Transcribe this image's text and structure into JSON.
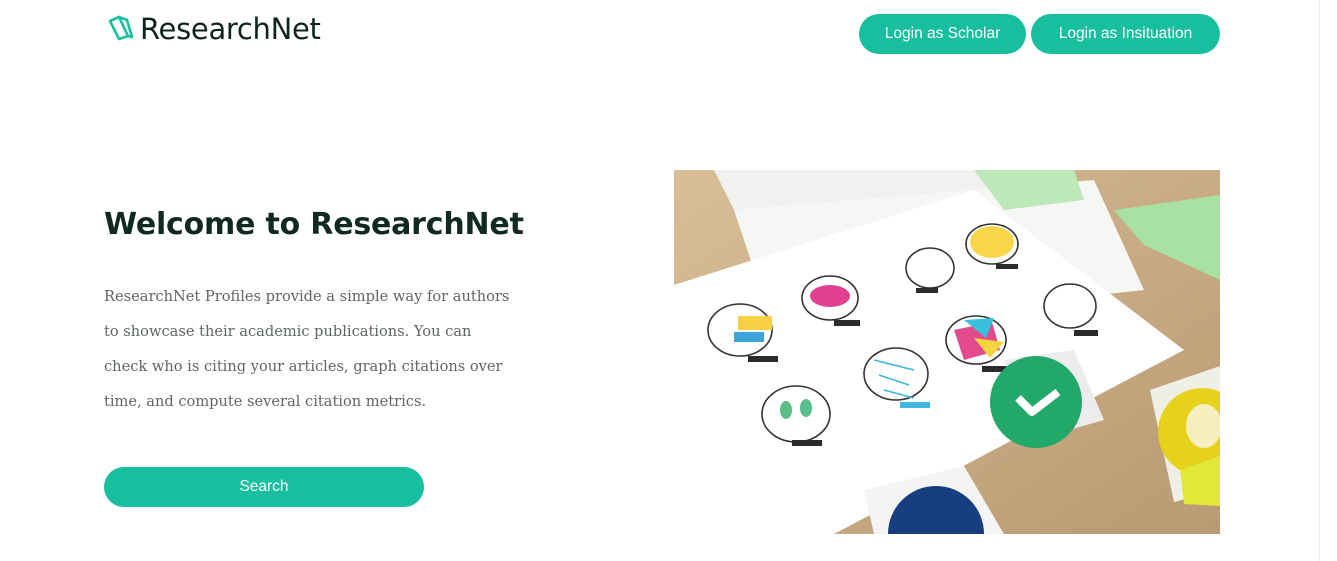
{
  "header": {
    "logo_text": "ResearchNet",
    "login_scholar_label": "Login as Scholar",
    "login_institution_label": "Login as Insituation"
  },
  "hero": {
    "title": "Welcome to ResearchNet",
    "description": "ResearchNet Profiles provide a simple way for authors to showcase their academic publications. You can check who is citing your articles, graph citations over time, and compute several citation metrics.",
    "search_label": "Search"
  },
  "colors": {
    "accent": "#17bf9e",
    "heading": "#102a22",
    "body_text": "#5e6663"
  },
  "icons": {
    "logo": "book-logo-icon",
    "hero_image": "lightbulb-sketches-photo"
  }
}
